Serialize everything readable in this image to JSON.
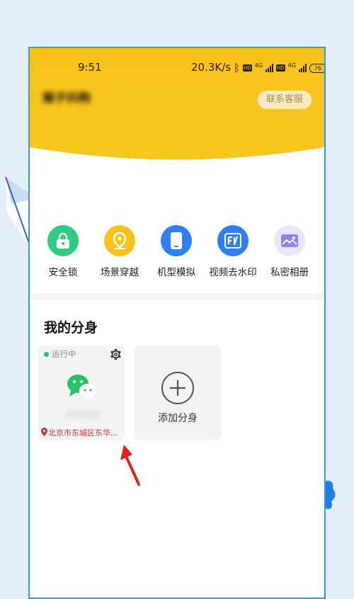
{
  "status_bar": {
    "time": "9:51",
    "net_speed": "20.3K/s",
    "hd_label": "HD",
    "network_gen": "4G",
    "battery": "76"
  },
  "header": {
    "profile_name": "猴子抖购",
    "contact_button": "联系客服",
    "gradient_color": "#f6c21a"
  },
  "features": [
    {
      "label": "安全锁",
      "icon": "lock-icon",
      "color": "#2fcc82"
    },
    {
      "label": "场景穿越",
      "icon": "location-pin-icon",
      "color": "#f6c21a"
    },
    {
      "label": "机型模拟",
      "icon": "phone-icon",
      "color": "#2f7ef5"
    },
    {
      "label": "视频去水印",
      "icon": "watermark-icon",
      "color": "#2f7ef5"
    },
    {
      "label": "私密相册",
      "icon": "album-icon",
      "color": "#e9e6fb"
    }
  ],
  "clones": {
    "title": "我的分身",
    "items": [
      {
        "status": "运行中",
        "app_icon": "wechat-icon",
        "location": "北京市东城区东华..."
      }
    ],
    "add_label": "添加分身"
  }
}
